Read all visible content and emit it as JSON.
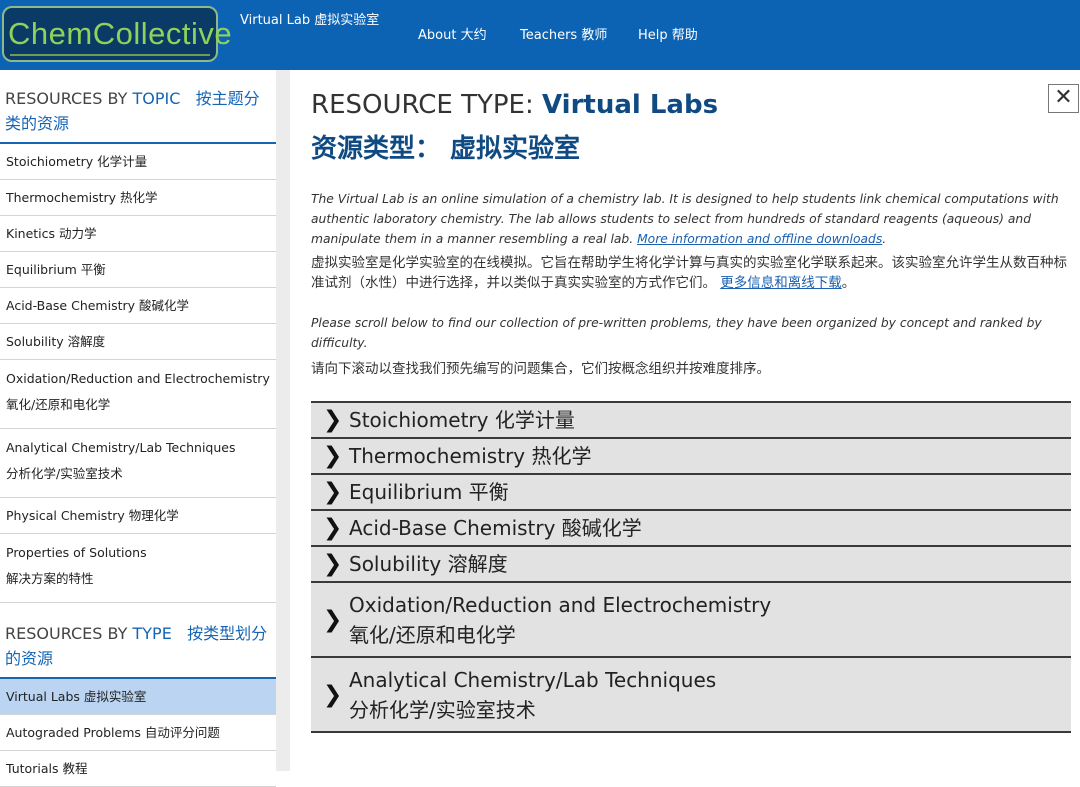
{
  "header": {
    "logo": "ChemCollective",
    "subtitle": "Virtual Lab  虚拟实验室",
    "nav": [
      {
        "label": "About  大约"
      },
      {
        "label": "Teachers  教师"
      },
      {
        "label": "Help  帮助"
      }
    ]
  },
  "sidebar": {
    "topic_heading": {
      "prefix": "RESOURCES BY ",
      "highlight": "TOPIC",
      "zh": "按主题分类的资源"
    },
    "topics": [
      {
        "label": "Stoichiometry  化学计量"
      },
      {
        "label": "Thermochemistry  热化学"
      },
      {
        "label": "Kinetics  动力学"
      },
      {
        "label": "Equilibrium  平衡"
      },
      {
        "label": "Acid-Base Chemistry  酸碱化学"
      },
      {
        "label": "Solubility  溶解度"
      },
      {
        "label": "Oxidation/Reduction and Electrochemistry",
        "zh": "氧化/还原和电化学"
      },
      {
        "label": "Analytical Chemistry/Lab Techniques",
        "zh": "分析化学/实验室技术"
      },
      {
        "label": "Physical Chemistry  物理化学"
      },
      {
        "label": "Properties of Solutions",
        "zh": "解决方案的特性"
      }
    ],
    "type_heading": {
      "prefix": "RESOURCES BY ",
      "highlight": "TYPE",
      "zh": "按类型划分的资源"
    },
    "types": [
      {
        "label": "Virtual Labs  虚拟实验室",
        "active": true
      },
      {
        "label": "Autograded Problems  自动评分问题"
      },
      {
        "label": "Tutorials  教程"
      }
    ]
  },
  "main": {
    "title_prefix": "RESOURCE TYPE: ",
    "title_highlight": "Virtual Labs",
    "title_zh": "资源类型：  虚拟实验室",
    "close_label": "✕",
    "desc_en": "The Virtual Lab is an online simulation of a chemistry lab. It is designed to help students link chemical computations with authentic laboratory chemistry. The lab allows students to select from hundreds of standard reagents (aqueous) and manipulate them in a manner resembling a real lab. ",
    "desc_link": "More information and offline downloads",
    "desc_zh": "虚拟实验室是化学实验室的在线模拟。它旨在帮助学生将化学计算与真实的实验室化学联系起来。该实验室允许学生从数百种标准试剂（水性）中进行选择，并以类似于真实实验室的方式作它们。",
    "desc_zh_link": "更多信息和离线下载",
    "desc_zh_end": "。",
    "scroll_en": "Please scroll below to find our collection of pre-written problems, they have been organized by concept and ranked by difficulty.",
    "scroll_zh": "请向下滚动以查找我们预先编写的问题集合，它们按概念组织并按难度排序。",
    "sections": [
      {
        "label": "Stoichiometry  化学计量"
      },
      {
        "label": "Thermochemistry  热化学"
      },
      {
        "label": "Equilibrium  平衡"
      },
      {
        "label": "Acid-Base Chemistry  酸碱化学"
      },
      {
        "label": "Solubility  溶解度"
      },
      {
        "label": "Oxidation/Reduction and Electrochemistry",
        "zh": "氧化/还原和电化学"
      },
      {
        "label": "Analytical Chemistry/Lab Techniques",
        "zh": "分析化学/实验室技术"
      }
    ]
  }
}
